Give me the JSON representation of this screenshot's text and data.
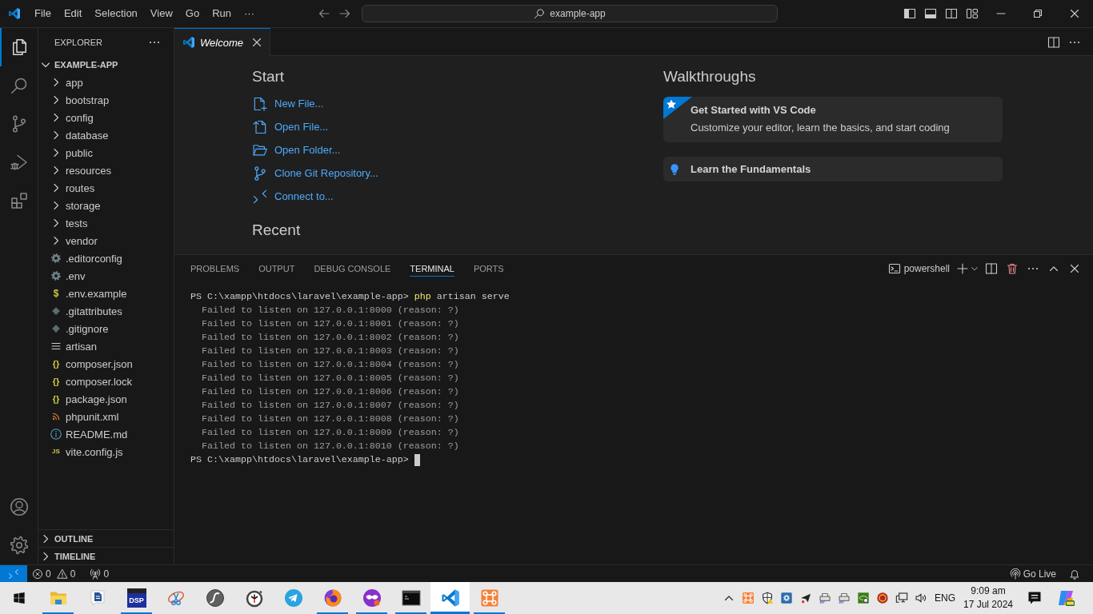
{
  "title_bar": {
    "menu": [
      "File",
      "Edit",
      "Selection",
      "View",
      "Go",
      "Run",
      "···"
    ],
    "command_center": "example-app"
  },
  "activity_bar": {
    "items": [
      {
        "kind": "explorer",
        "selected": true
      },
      {
        "kind": "search",
        "selected": false
      },
      {
        "kind": "source-control",
        "selected": false
      },
      {
        "kind": "run-debug",
        "selected": false
      },
      {
        "kind": "extensions",
        "selected": false
      }
    ]
  },
  "sidebar": {
    "title": "EXPLORER",
    "folder": {
      "name": "EXAMPLE-APP",
      "expanded": true,
      "children": [
        {
          "name": "app",
          "kind": "folder",
          "expanded": false
        },
        {
          "name": "bootstrap",
          "kind": "folder",
          "expanded": false
        },
        {
          "name": "config",
          "kind": "folder",
          "expanded": false
        },
        {
          "name": "database",
          "kind": "folder",
          "expanded": false
        },
        {
          "name": "public",
          "kind": "folder",
          "expanded": false
        },
        {
          "name": "resources",
          "kind": "folder",
          "expanded": false
        },
        {
          "name": "routes",
          "kind": "folder",
          "expanded": false
        },
        {
          "name": "storage",
          "kind": "folder",
          "expanded": false
        },
        {
          "name": "tests",
          "kind": "folder",
          "expanded": false
        },
        {
          "name": "vendor",
          "kind": "folder",
          "expanded": false
        },
        {
          "name": ".editorconfig",
          "kind": "config"
        },
        {
          "name": ".env",
          "kind": "config"
        },
        {
          "name": ".env.example",
          "kind": "env",
          "icon": "$"
        },
        {
          "name": ".gitattributes",
          "kind": "git"
        },
        {
          "name": ".gitignore",
          "kind": "git"
        },
        {
          "name": "artisan",
          "kind": "text"
        },
        {
          "name": "composer.json",
          "kind": "json",
          "icon": "{}"
        },
        {
          "name": "composer.lock",
          "kind": "json",
          "icon": "{}"
        },
        {
          "name": "package.json",
          "kind": "json",
          "icon": "{}"
        },
        {
          "name": "phpunit.xml",
          "kind": "xml"
        },
        {
          "name": "README.md",
          "kind": "markdown"
        },
        {
          "name": "vite.config.js",
          "kind": "js",
          "icon": "JS"
        }
      ]
    },
    "sections": [
      {
        "name": "OUTLINE",
        "expanded": false
      },
      {
        "name": "TIMELINE",
        "expanded": false
      }
    ]
  },
  "editor": {
    "tabs": [
      {
        "label": "Welcome",
        "selected": true
      }
    ]
  },
  "welcome": {
    "start": {
      "title": "Start",
      "items": [
        {
          "label": "New File...",
          "kind": "new-file"
        },
        {
          "label": "Open File...",
          "kind": "open-file"
        },
        {
          "label": "Open Folder...",
          "kind": "open-folder"
        },
        {
          "label": "Clone Git Repository...",
          "kind": "clone"
        },
        {
          "label": "Connect to...",
          "kind": "remote"
        }
      ]
    },
    "recent": {
      "title": "Recent"
    },
    "walkthroughs": {
      "title": "Walkthroughs",
      "items": [
        {
          "kind": "featured",
          "title": "Get Started with VS Code",
          "description": "Customize your editor, learn the basics, and start coding"
        },
        {
          "kind": "lightbulb",
          "title": "Learn the Fundamentals"
        }
      ]
    }
  },
  "panel": {
    "tabs": [
      {
        "label": "PROBLEMS",
        "selected": false
      },
      {
        "label": "OUTPUT",
        "selected": false
      },
      {
        "label": "DEBUG CONSOLE",
        "selected": false
      },
      {
        "label": "TERMINAL",
        "selected": true
      },
      {
        "label": "PORTS",
        "selected": false
      }
    ],
    "terminal": {
      "profile": "powershell",
      "lines": [
        {
          "kind": "command",
          "prompt": "PS C:\\xampp\\htdocs\\laravel\\example-app>",
          "command": "php",
          "args": "artisan serve",
          "cursor": false
        },
        {
          "kind": "output",
          "text": "Failed to listen on 127.0.0.1:8000 (reason: ?)",
          "cursor": false
        },
        {
          "kind": "output",
          "text": "Failed to listen on 127.0.0.1:8001 (reason: ?)",
          "cursor": false
        },
        {
          "kind": "output",
          "text": "Failed to listen on 127.0.0.1:8002 (reason: ?)",
          "cursor": false
        },
        {
          "kind": "output",
          "text": "Failed to listen on 127.0.0.1:8003 (reason: ?)",
          "cursor": false
        },
        {
          "kind": "output",
          "text": "Failed to listen on 127.0.0.1:8004 (reason: ?)",
          "cursor": false
        },
        {
          "kind": "output",
          "text": "Failed to listen on 127.0.0.1:8005 (reason: ?)",
          "cursor": false
        },
        {
          "kind": "output",
          "text": "Failed to listen on 127.0.0.1:8006 (reason: ?)",
          "cursor": false
        },
        {
          "kind": "output",
          "text": "Failed to listen on 127.0.0.1:8007 (reason: ?)",
          "cursor": false
        },
        {
          "kind": "output",
          "text": "Failed to listen on 127.0.0.1:8008 (reason: ?)",
          "cursor": false
        },
        {
          "kind": "output",
          "text": "Failed to listen on 127.0.0.1:8009 (reason: ?)",
          "cursor": false
        },
        {
          "kind": "output",
          "text": "Failed to listen on 127.0.0.1:8010 (reason: ?)",
          "cursor": false
        },
        {
          "kind": "prompt",
          "prompt": "PS C:\\xampp\\htdocs\\laravel\\example-app>",
          "cursor": true
        }
      ]
    }
  },
  "status_bar": {
    "errors": "0",
    "warnings": "0",
    "ports": "0",
    "go_live": "Go Live"
  },
  "taskbar": {
    "apps": [
      {
        "kind": "folder",
        "running": true,
        "selected": false
      },
      {
        "kind": "document",
        "running": false,
        "selected": false
      },
      {
        "kind": "dsp",
        "label": "DSP",
        "running": true,
        "selected": false
      },
      {
        "kind": "scissors",
        "running": false,
        "selected": false
      },
      {
        "kind": "sphere",
        "running": false,
        "selected": false
      },
      {
        "kind": "stopwatch",
        "running": false,
        "selected": false
      },
      {
        "kind": "paper-plane",
        "running": false,
        "selected": false
      },
      {
        "kind": "fox-globe",
        "running": true,
        "selected": false
      },
      {
        "kind": "mask",
        "running": true,
        "selected": false
      },
      {
        "kind": "terminal",
        "running": true,
        "selected": false
      },
      {
        "kind": "editor",
        "running": true,
        "selected": true
      },
      {
        "kind": "pretzel",
        "running": true,
        "selected": false
      }
    ],
    "tray": {
      "language": "ENG",
      "time": "9:09 am",
      "date": "17 Jul 2024"
    }
  }
}
